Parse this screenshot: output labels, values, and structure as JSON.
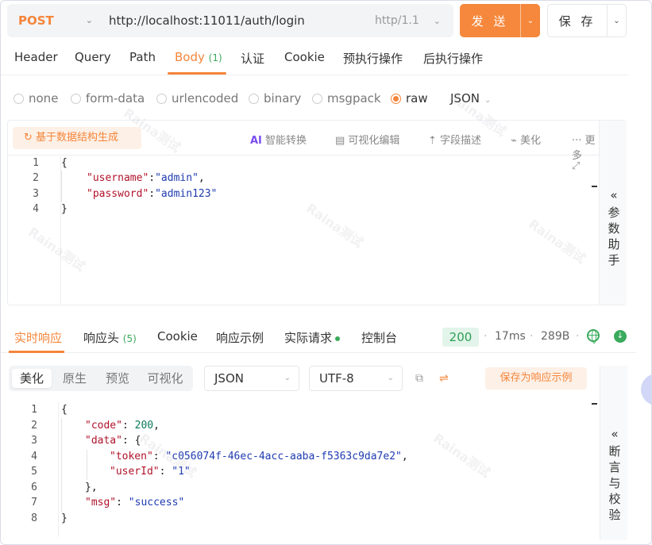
{
  "request": {
    "method": "POST",
    "url": "http://localhost:11011/auth/login",
    "protocol": "http/1.1",
    "send_label": "发 送",
    "save_label": "保 存"
  },
  "request_tabs": [
    {
      "label": "Header"
    },
    {
      "label": "Query"
    },
    {
      "label": "Path"
    },
    {
      "label": "Body",
      "badge": "(1)"
    },
    {
      "label": "认证"
    },
    {
      "label": "Cookie"
    },
    {
      "label": "预执行操作"
    },
    {
      "label": "后执行操作"
    }
  ],
  "body_types": [
    "none",
    "form-data",
    "urlencoded",
    "binary",
    "msgpack",
    "raw"
  ],
  "body_type_selected": "raw",
  "raw_format": "JSON",
  "editor_toolbar": {
    "generate": "基于数据结构生成",
    "ai_prefix": "AI",
    "ai_convert": "智能转换",
    "visual_edit": "可视化编辑",
    "field_desc": "字段描述",
    "beautify": "美化",
    "more": "更多"
  },
  "request_body_lines": [
    {
      "n": "1",
      "text": "{"
    },
    {
      "n": "2",
      "key": "\"username\"",
      "sep": ":",
      "val": "\"admin\"",
      "tail": ","
    },
    {
      "n": "3",
      "key": "\"password\"",
      "sep": ":",
      "val": "\"admin123\"",
      "tail": ""
    },
    {
      "n": "4",
      "text": "}"
    }
  ],
  "param_helper": "参数助手",
  "response_tabs": [
    {
      "label": "实时响应"
    },
    {
      "label": "响应头",
      "badge": "(5)"
    },
    {
      "label": "Cookie"
    },
    {
      "label": "响应示例"
    },
    {
      "label": "实际请求"
    },
    {
      "label": "控制台"
    }
  ],
  "response_meta": {
    "status": "200",
    "time": "17ms",
    "size": "289B"
  },
  "view_modes": [
    "美化",
    "原生",
    "预览",
    "可视化"
  ],
  "view_mode_selected": "美化",
  "resp_format": "JSON",
  "resp_encoding": "UTF-8",
  "save_as_example": "保存为响应示例",
  "response_body_lines": [
    {
      "n": "1",
      "text": "{"
    },
    {
      "n": "2",
      "key": "\"code\"",
      "sep": ": ",
      "val": "200",
      "tail": ","
    },
    {
      "n": "3",
      "key": "\"data\"",
      "sep": ": ",
      "val": "{",
      "tail": ""
    },
    {
      "n": "4",
      "key": "\"token\"",
      "sep": ": ",
      "val": "\"c056074f-46ec-4acc-aaba-f5363c9da7e2\"",
      "tail": ","
    },
    {
      "n": "5",
      "key": "\"userId\"",
      "sep": ": ",
      "val": "\"1\"",
      "tail": ""
    },
    {
      "n": "6",
      "text": "},"
    },
    {
      "n": "7",
      "key": "\"msg\"",
      "sep": ": ",
      "val": "\"success\"",
      "tail": ""
    },
    {
      "n": "8",
      "text": "}"
    }
  ],
  "assert_helper": "断言与校验",
  "watermark": "Raina测试"
}
